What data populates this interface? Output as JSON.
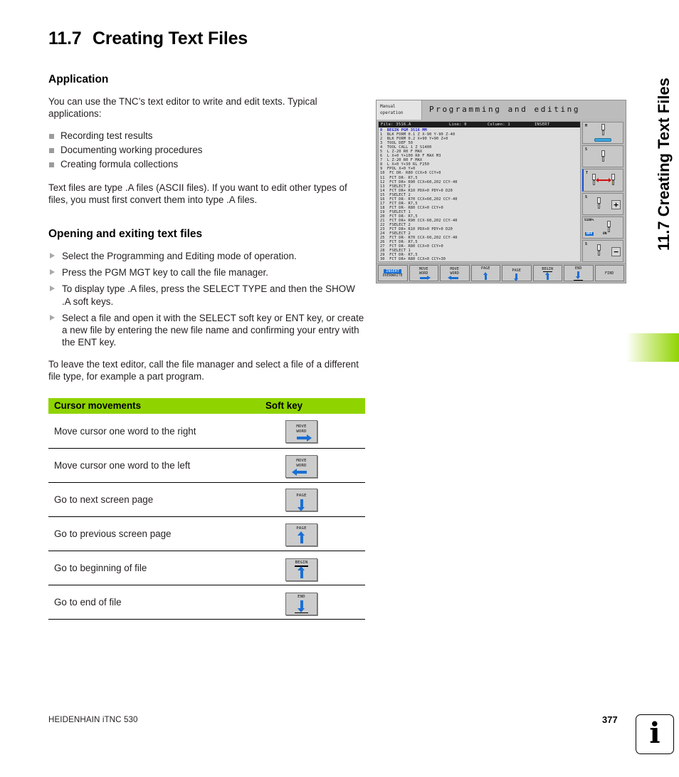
{
  "page": {
    "chapter_number": "11.7",
    "chapter_title": "Creating Text Files",
    "running_title": "11.7 Creating Text Files",
    "footer_brand": "HEIDENHAIN iTNC 530",
    "page_number": "377",
    "info_icon_glyph": "i",
    "accent_green": "#8fd400"
  },
  "application": {
    "heading": "Application",
    "intro": "You can use the TNC’s text editor to write and edit texts. Typical applications:",
    "bullets": [
      "Recording test results",
      "Documenting working procedures",
      "Creating formula collections"
    ],
    "note": "Text files are type .A files (ASCII files). If you want to edit other types of files, you must first convert them into type .A files."
  },
  "opening": {
    "heading": "Opening and exiting text files",
    "steps": [
      "Select the Programming and Editing mode of operation.",
      "Press the PGM MGT key to call the file manager.",
      "To display type .A files, press the SELECT TYPE and then the SHOW .A soft keys.",
      "Select a file and open it with the SELECT soft key or ENT key, or create a new file by entering the new file name and confirming your entry with the ENT key."
    ],
    "closing": "To leave the text editor, call the file manager and select a file of a different file type, for example a part program."
  },
  "table": {
    "header_action": "Cursor movements",
    "header_softkey": "Soft key",
    "rows": [
      {
        "action": "Move cursor one word to the right",
        "key_line1": "MOVE",
        "key_line2": "WORD",
        "icon": "arrow-right-icon"
      },
      {
        "action": "Move cursor one word to the left",
        "key_line1": "MOVE",
        "key_line2": "WORD",
        "icon": "arrow-left-icon"
      },
      {
        "action": "Go to next screen page",
        "key_line1": "PAGE",
        "key_line2": "",
        "icon": "arrow-down-icon"
      },
      {
        "action": "Go to previous screen page",
        "key_line1": "PAGE",
        "key_line2": "",
        "icon": "arrow-up-icon"
      },
      {
        "action": "Go to beginning of file",
        "key_line1": "BEGIN",
        "key_line2": "",
        "icon": "arrow-up-bar-icon"
      },
      {
        "action": "Go to end of file",
        "key_line1": "END",
        "key_line2": "",
        "icon": "arrow-down-bar-icon"
      }
    ]
  },
  "cnc": {
    "mode_line1": "Manual",
    "mode_line2": "operation",
    "title": "Programming and editing",
    "status": {
      "file": "File: 3516.A",
      "line": "Line: 0",
      "column": "Column: 1",
      "mode": "INSERT"
    },
    "code": [
      "0  BEGIN PGM 3516 MM",
      "1  BLK FORM 0.1 Z X-90 Y-90 Z-40",
      "2  BLK FORM 0.2 X+90 Y+90 Z+0",
      "3  TOOL DEF 50",
      "4  TOOL CALL 1 Z S1400",
      "5  L Z-20 R0 F MAX",
      "6  L X+0 Y+100 R0 F MAX M3",
      "7  L Z-20 R0 F MAX",
      "8  L X+0 Y+30 RL F250",
      "9  FPOL X+0 Y+0",
      "10  FC DR- R80 CCX+0 CCY+0",
      "11  FCT DR- R7,5",
      "12  FCT DR+ R90 CCX+60,202 CCY-40",
      "13  FSELECT 2",
      "14  FCT DR+ R10 PDX+0 PDY+0 D20",
      "15  FSELECT 2",
      "16  FCT DR- R70 CCX+60,202 CCY-40",
      "17  FCT DR- R7,5",
      "18  FCT DR- R80 CCX+0 CCY+0",
      "19  FSELECT 1",
      "20  FCT DR- R7,5",
      "21  FCT DR+ R90 CCX-60,202 CCY-40",
      "22  FSELECT 2",
      "23  FCT DR+ R10 PDX+0 PDY+0 D20",
      "24  FSELECT 2",
      "25  FCT DR- R70 CCX-60,202 CCY-40",
      "26  FCT DR- R7,5",
      "27  FCT DR- R80 CCX+0 CCY+0",
      "28  FSELECT 1",
      "29  FCT DR- R7,5",
      "30  FCT DR+ R80 CCX+0 CCY+30"
    ],
    "side_icons": [
      {
        "name": "machine-table-icon",
        "tag": "M"
      },
      {
        "name": "spindle-tool-icon",
        "tag": "S"
      },
      {
        "name": "tool-change-icon",
        "tag": "T"
      },
      {
        "name": "spindle-plus-icon",
        "tag": "S",
        "extra": "+"
      },
      {
        "name": "spindle-override-icon",
        "tag": "S100%",
        "off": "OFF",
        "on": "ON"
      },
      {
        "name": "spindle-minus-icon",
        "tag": "S",
        "extra": "−"
      }
    ],
    "softkeys": [
      {
        "name": "insert-overwrite-softkey",
        "line1": "INSERT",
        "line2": "OVERWRITE",
        "icon": "none"
      },
      {
        "name": "move-word-right-softkey",
        "line1": "MOVE",
        "line2": "WORD",
        "icon": "arrow-right-icon"
      },
      {
        "name": "move-word-left-softkey",
        "line1": "MOVE",
        "line2": "WORD",
        "icon": "arrow-left-icon"
      },
      {
        "name": "page-up-softkey",
        "line1": "PAGE",
        "line2": "",
        "icon": "arrow-up-icon"
      },
      {
        "name": "page-down-softkey",
        "line1": "PAGE",
        "line2": "",
        "icon": "arrow-down-icon"
      },
      {
        "name": "begin-softkey",
        "line1": "BEGIN",
        "line2": "",
        "icon": "arrow-up-bar-icon"
      },
      {
        "name": "end-softkey",
        "line1": "END",
        "line2": "",
        "icon": "arrow-down-bar-icon"
      },
      {
        "name": "find-softkey",
        "line1": "FIND",
        "line2": "",
        "icon": "none"
      }
    ]
  }
}
